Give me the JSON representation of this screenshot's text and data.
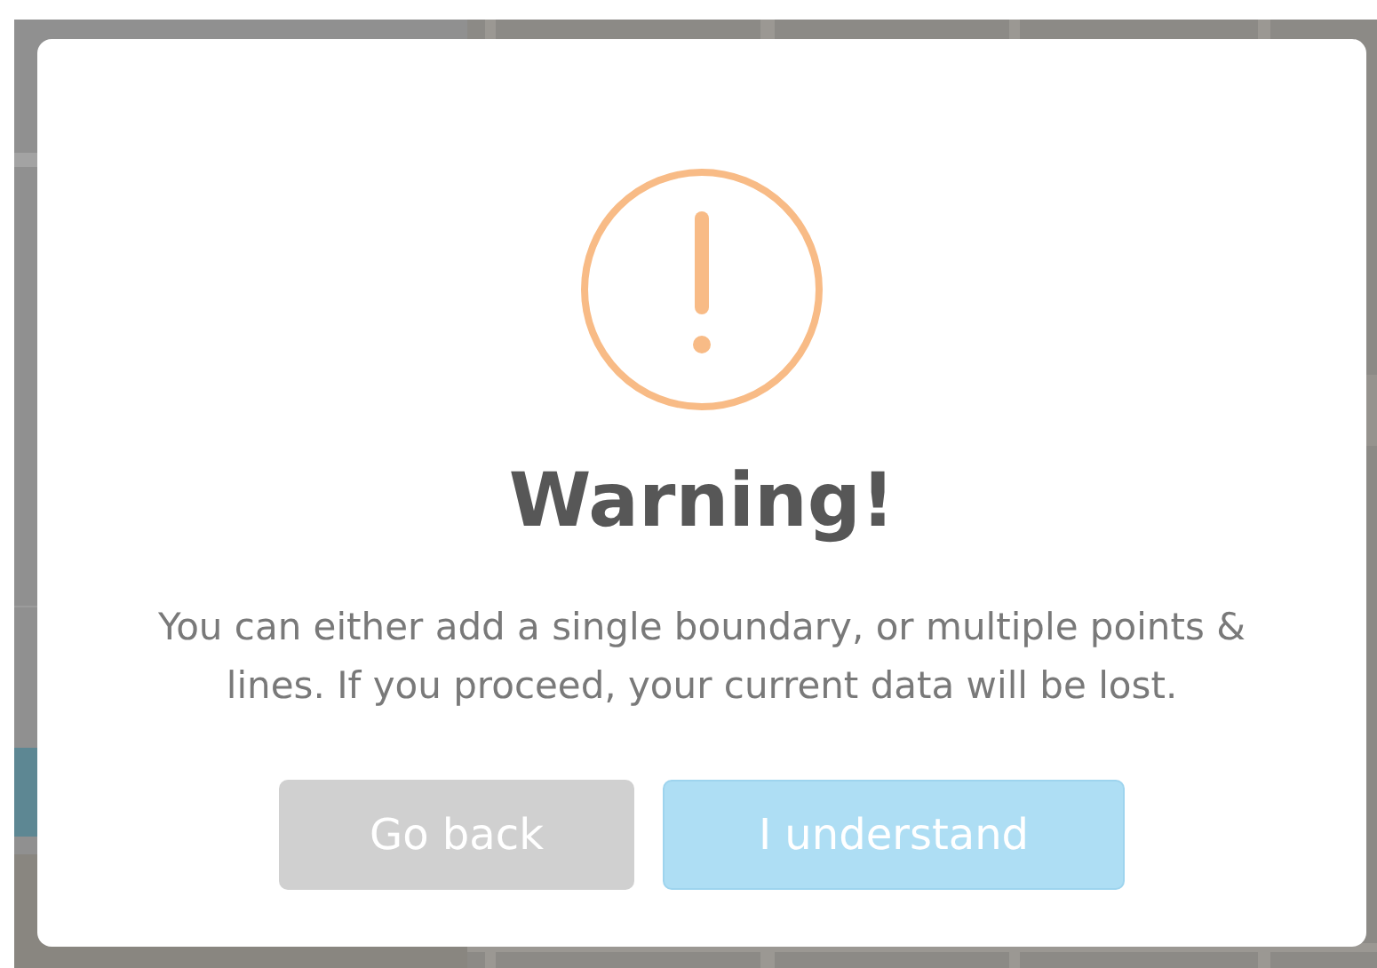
{
  "dialog": {
    "kind": "warning",
    "title": "Warning!",
    "message": "You can either add a single boundary, or multiple points & lines. If you proceed, your current data will be lost.",
    "buttons": [
      {
        "label": "Go back",
        "kind": "cancel"
      },
      {
        "label": "I understand",
        "kind": "confirm"
      }
    ]
  }
}
